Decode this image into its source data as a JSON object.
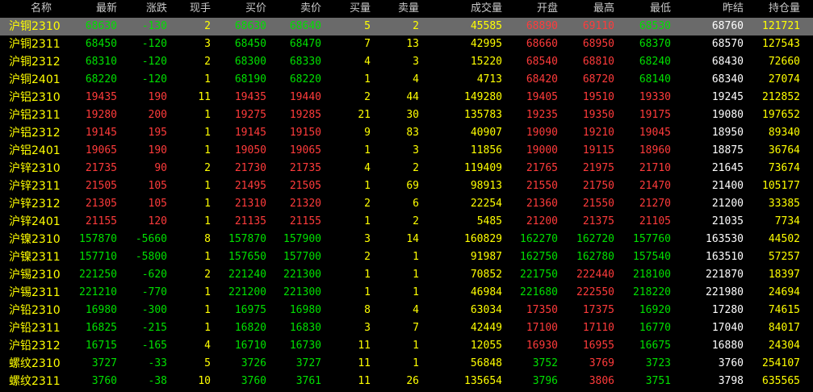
{
  "colors": {
    "up": "#ff3b3b",
    "down": "#00e000",
    "flat": "#e6e6e6",
    "neutral": "#ffffff",
    "volume": "#ffff00",
    "name": "#ffff00",
    "selected_row_bg": "#6a6a6a"
  },
  "headers": [
    "名称",
    "最新",
    "涨跌",
    "现手",
    "买价",
    "卖价",
    "买量",
    "卖量",
    "成交量",
    "开盘",
    "最高",
    "最低",
    "昨结",
    "持仓量"
  ],
  "selected_row": 0,
  "rows": [
    {
      "name": "沪铜2310",
      "last": "68630",
      "chg": "-130",
      "now": "2",
      "bid": "68630",
      "ask": "68640",
      "bidv": "5",
      "askv": "2",
      "vol": "45585",
      "open": "68890",
      "high": "69110",
      "low": "68530",
      "prev": "68760",
      "oi": "121721"
    },
    {
      "name": "沪铜2311",
      "last": "68450",
      "chg": "-120",
      "now": "3",
      "bid": "68450",
      "ask": "68470",
      "bidv": "7",
      "askv": "13",
      "vol": "42995",
      "open": "68660",
      "high": "68950",
      "low": "68370",
      "prev": "68570",
      "oi": "127543"
    },
    {
      "name": "沪铜2312",
      "last": "68310",
      "chg": "-120",
      "now": "2",
      "bid": "68300",
      "ask": "68330",
      "bidv": "4",
      "askv": "3",
      "vol": "15220",
      "open": "68540",
      "high": "68810",
      "low": "68240",
      "prev": "68430",
      "oi": "72660"
    },
    {
      "name": "沪铜2401",
      "last": "68220",
      "chg": "-120",
      "now": "1",
      "bid": "68190",
      "ask": "68220",
      "bidv": "1",
      "askv": "4",
      "vol": "4713",
      "open": "68420",
      "high": "68720",
      "low": "68140",
      "prev": "68340",
      "oi": "27074"
    },
    {
      "name": "沪铝2310",
      "last": "19435",
      "chg": "190",
      "now": "11",
      "bid": "19435",
      "ask": "19440",
      "bidv": "2",
      "askv": "44",
      "vol": "149280",
      "open": "19405",
      "high": "19510",
      "low": "19330",
      "prev": "19245",
      "oi": "212852"
    },
    {
      "name": "沪铝2311",
      "last": "19280",
      "chg": "200",
      "now": "1",
      "bid": "19275",
      "ask": "19285",
      "bidv": "21",
      "askv": "30",
      "vol": "135783",
      "open": "19235",
      "high": "19350",
      "low": "19175",
      "prev": "19080",
      "oi": "197652"
    },
    {
      "name": "沪铝2312",
      "last": "19145",
      "chg": "195",
      "now": "1",
      "bid": "19145",
      "ask": "19150",
      "bidv": "9",
      "askv": "83",
      "vol": "40907",
      "open": "19090",
      "high": "19210",
      "low": "19045",
      "prev": "18950",
      "oi": "89340"
    },
    {
      "name": "沪铝2401",
      "last": "19065",
      "chg": "190",
      "now": "1",
      "bid": "19050",
      "ask": "19065",
      "bidv": "1",
      "askv": "3",
      "vol": "11856",
      "open": "19000",
      "high": "19115",
      "low": "18960",
      "prev": "18875",
      "oi": "36764"
    },
    {
      "name": "沪锌2310",
      "last": "21735",
      "chg": "90",
      "now": "2",
      "bid": "21730",
      "ask": "21735",
      "bidv": "4",
      "askv": "2",
      "vol": "119409",
      "open": "21765",
      "high": "21975",
      "low": "21710",
      "prev": "21645",
      "oi": "73674"
    },
    {
      "name": "沪锌2311",
      "last": "21505",
      "chg": "105",
      "now": "1",
      "bid": "21495",
      "ask": "21505",
      "bidv": "1",
      "askv": "69",
      "vol": "98913",
      "open": "21550",
      "high": "21750",
      "low": "21470",
      "prev": "21400",
      "oi": "105177"
    },
    {
      "name": "沪锌2312",
      "last": "21305",
      "chg": "105",
      "now": "1",
      "bid": "21310",
      "ask": "21320",
      "bidv": "2",
      "askv": "6",
      "vol": "22254",
      "open": "21360",
      "high": "21550",
      "low": "21270",
      "prev": "21200",
      "oi": "33385"
    },
    {
      "name": "沪锌2401",
      "last": "21155",
      "chg": "120",
      "now": "1",
      "bid": "21135",
      "ask": "21155",
      "bidv": "1",
      "askv": "2",
      "vol": "5485",
      "open": "21200",
      "high": "21375",
      "low": "21105",
      "prev": "21035",
      "oi": "7734"
    },
    {
      "name": "沪镍2310",
      "last": "157870",
      "chg": "-5660",
      "now": "8",
      "bid": "157870",
      "ask": "157900",
      "bidv": "3",
      "askv": "14",
      "vol": "160829",
      "open": "162270",
      "high": "162720",
      "low": "157760",
      "prev": "163530",
      "oi": "44502"
    },
    {
      "name": "沪镍2311",
      "last": "157710",
      "chg": "-5800",
      "now": "1",
      "bid": "157650",
      "ask": "157700",
      "bidv": "2",
      "askv": "1",
      "vol": "91987",
      "open": "162750",
      "high": "162780",
      "low": "157540",
      "prev": "163510",
      "oi": "57257"
    },
    {
      "name": "沪锡2310",
      "last": "221250",
      "chg": "-620",
      "now": "2",
      "bid": "221240",
      "ask": "221300",
      "bidv": "1",
      "askv": "1",
      "vol": "70852",
      "open": "221750",
      "high": "222440",
      "low": "218100",
      "prev": "221870",
      "oi": "18397"
    },
    {
      "name": "沪锡2311",
      "last": "221210",
      "chg": "-770",
      "now": "1",
      "bid": "221200",
      "ask": "221300",
      "bidv": "1",
      "askv": "1",
      "vol": "46984",
      "open": "221680",
      "high": "222550",
      "low": "218220",
      "prev": "221980",
      "oi": "24694"
    },
    {
      "name": "沪铅2310",
      "last": "16980",
      "chg": "-300",
      "now": "1",
      "bid": "16975",
      "ask": "16980",
      "bidv": "8",
      "askv": "4",
      "vol": "63034",
      "open": "17350",
      "high": "17375",
      "low": "16920",
      "prev": "17280",
      "oi": "74615"
    },
    {
      "name": "沪铅2311",
      "last": "16825",
      "chg": "-215",
      "now": "1",
      "bid": "16820",
      "ask": "16830",
      "bidv": "3",
      "askv": "7",
      "vol": "42449",
      "open": "17100",
      "high": "17110",
      "low": "16770",
      "prev": "17040",
      "oi": "84017"
    },
    {
      "name": "沪铅2312",
      "last": "16715",
      "chg": "-165",
      "now": "4",
      "bid": "16710",
      "ask": "16730",
      "bidv": "11",
      "askv": "1",
      "vol": "12055",
      "open": "16930",
      "high": "16955",
      "low": "16675",
      "prev": "16880",
      "oi": "24304"
    },
    {
      "name": "螺纹2310",
      "last": "3727",
      "chg": "-33",
      "now": "5",
      "bid": "3726",
      "ask": "3727",
      "bidv": "11",
      "askv": "1",
      "vol": "56848",
      "open": "3752",
      "high": "3769",
      "low": "3723",
      "prev": "3760",
      "oi": "254107"
    },
    {
      "name": "螺纹2311",
      "last": "3760",
      "chg": "-38",
      "now": "10",
      "bid": "3760",
      "ask": "3761",
      "bidv": "11",
      "askv": "26",
      "vol": "135654",
      "open": "3796",
      "high": "3806",
      "low": "3751",
      "prev": "3798",
      "oi": "635565"
    }
  ]
}
